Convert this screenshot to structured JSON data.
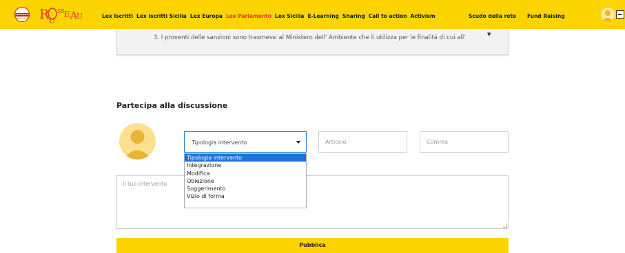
{
  "header": {
    "brand_m5s_text": "MOVIMENTO",
    "nav": [
      {
        "label": "Lex Iscritti",
        "active": false
      },
      {
        "label": "Lex Iscritti Sicilia",
        "active": false
      },
      {
        "label": "Lex Europa",
        "active": false
      },
      {
        "label": "Lex Parlamento",
        "active": true
      },
      {
        "label": "Lex Sicilia",
        "active": false
      },
      {
        "label": "E-Learning",
        "active": false
      },
      {
        "label": "Sharing",
        "active": false
      },
      {
        "label": "Call to action",
        "active": false
      },
      {
        "label": "Activism",
        "active": false
      }
    ],
    "nav_right": {
      "scudo": "Scudo della rete",
      "fund": "Fund Raising"
    },
    "colors": {
      "bar": "#fcd400",
      "active": "#e33b2e"
    }
  },
  "law": {
    "text": "3. I proventi delle sanzioni sono trasmessi al Ministero dell' Ambiente che li utilizza per le finalità di cui all'"
  },
  "discussion": {
    "title": "Partecipa alla discussione",
    "select": {
      "value": "Tipologia intervento",
      "options": [
        "Tipologia intervento",
        "Integrazione",
        "Modifica",
        "Obiezione",
        "Suggerimento",
        "Vizio di forma"
      ],
      "selected_index": 0
    },
    "articolo_placeholder": "Articolo",
    "comma_placeholder": "Comma",
    "textarea_placeholder": "Il tuo intervento",
    "publish_label": "Pubblica"
  }
}
